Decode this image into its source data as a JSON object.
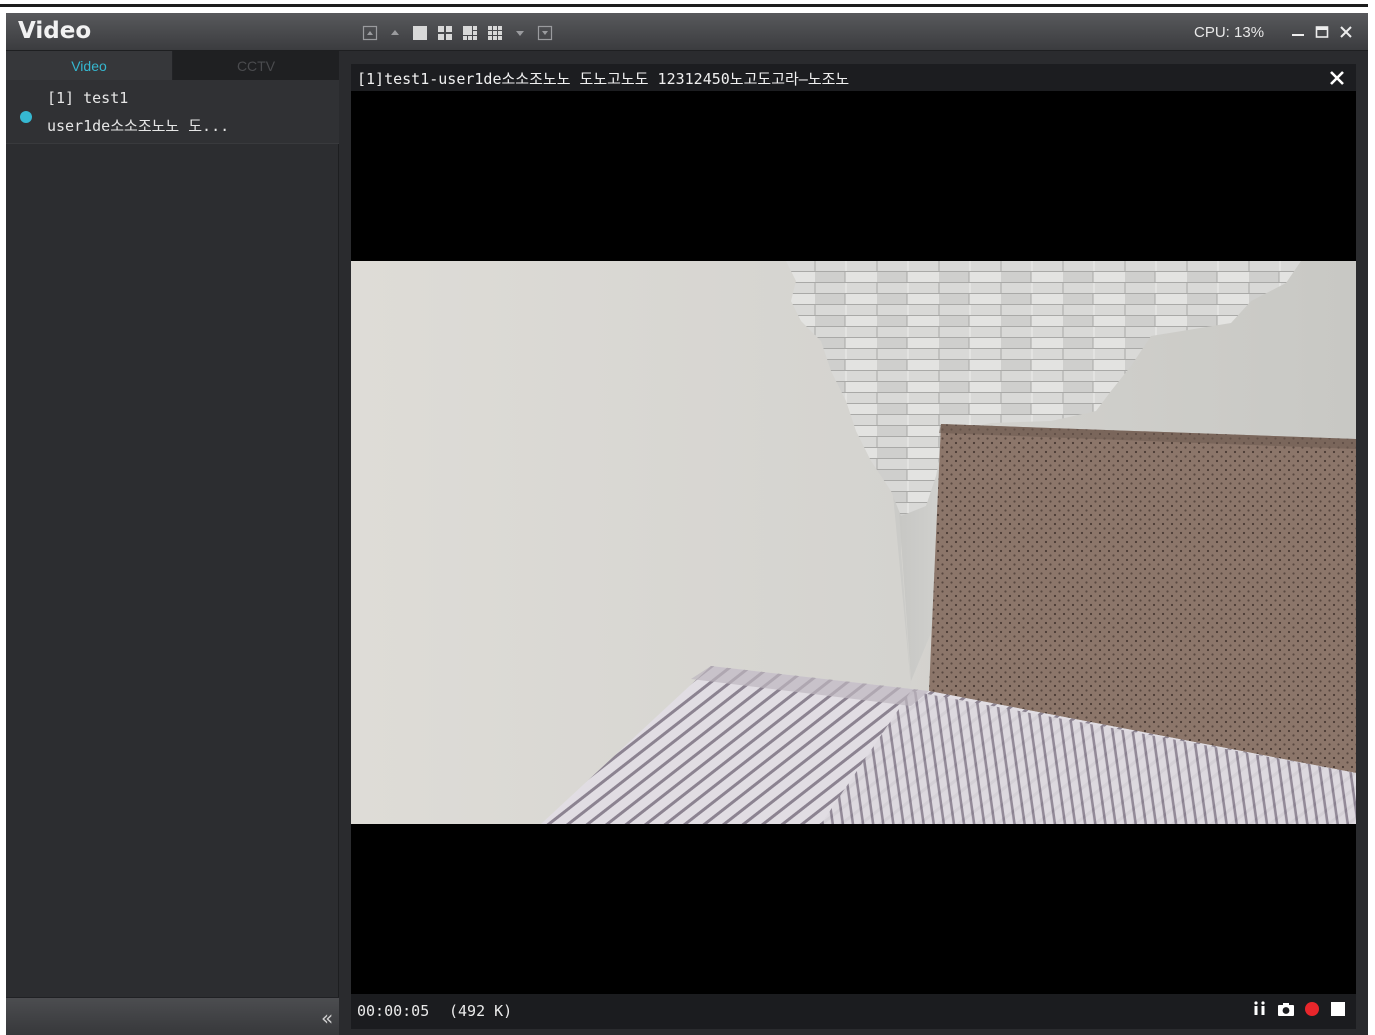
{
  "app": {
    "title": "Video"
  },
  "toolbar": {
    "layout_icons": [
      "scroll-up-icon",
      "arrow-up-icon",
      "single-view-icon",
      "quad-view-icon",
      "six-view-icon",
      "nine-view-icon",
      "arrow-down-icon",
      "scroll-down-icon"
    ]
  },
  "status": {
    "cpu": "CPU: 13%"
  },
  "window_controls": [
    "minimize-icon",
    "maximize-icon",
    "close-icon"
  ],
  "sidebar": {
    "tabs": [
      {
        "label": "Video",
        "active": true
      },
      {
        "label": "CCTV",
        "active": false
      }
    ],
    "channels": [
      {
        "line1": "[1] test1",
        "line2": "user1de소소조노노 도...",
        "status_color": "#36b8d2"
      }
    ],
    "collapse_label": "«"
  },
  "viewer": {
    "title": "[1]test1-user1de소소조노노 도노고노도 12312450노고도고라—노조노",
    "time": "00:00:05",
    "size": "(492 K)",
    "controls": [
      "audio-icon",
      "snapshot-icon",
      "record-icon",
      "stop-icon"
    ],
    "record_color": "#e8262b"
  }
}
